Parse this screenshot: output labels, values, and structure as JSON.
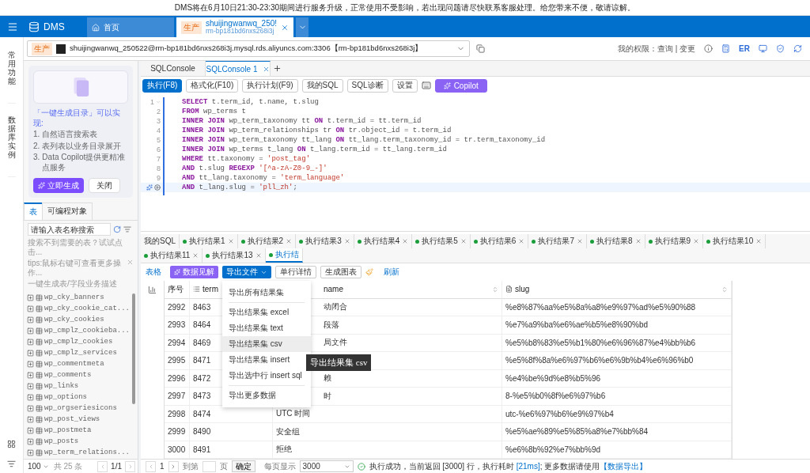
{
  "notice": "DMS将在6月10日21:30-23:30期间进行服务升级，正常使用不受影响，若出现问题请尽快联系客服处理。给您带来不便，敬请谅解。",
  "header": {
    "logo": "DMS",
    "tabs": [
      {
        "kind": "home",
        "title": "首页",
        "selected": false
      },
      {
        "kind": "db",
        "tag": "生产",
        "title": "shuijingwanwq_250!",
        "subtitle": "rm-bp181bd6nxs268i3j",
        "selected": true
      }
    ]
  },
  "rail": {
    "items": [
      "常用功能",
      "数据库实例"
    ]
  },
  "connection": {
    "tag": "生产",
    "text": "shuijingwanwq_250522@rm-bp181bd6nxs268i3j.mysql.rds.aliyuncs.com:3306【rm-bp181bd6nxs268i3j】",
    "permission_label": "我的权限：",
    "permission_query": "查询",
    "permission_sep": "|",
    "permission_change": "变更",
    "er": "ER"
  },
  "copilot_card": {
    "title": "「一键生成目录」可以实现:",
    "points": [
      {
        "no": "1.",
        "text": "自然语言搜索表"
      },
      {
        "no": "2.",
        "text": "表列表以业务目录展开"
      },
      {
        "no": "3.",
        "text": "Data Copilot提供更精准点服务"
      }
    ],
    "primary": "立即生成",
    "secondary": "关闭"
  },
  "object_tabs": [
    {
      "label": "表",
      "selected": true
    },
    {
      "label": "可编程对象",
      "selected": false
    }
  ],
  "table_search": {
    "placeholder": "请输入表名称搜索"
  },
  "hints": [
    {
      "text": "搜索不到需要的表？试试点击...",
      "closable": false
    },
    {
      "text": "tips:鼠标右键可查看更多操作...",
      "closable": true
    },
    {
      "text": "一键生成表/字段业务描述",
      "closable": false
    }
  ],
  "tables": [
    "wp_cky_banners",
    "wp_cky_cookie_cat...",
    "wp_cky_cookies",
    "wp_cmplz_cookieba...",
    "wp_cmplz_cookies",
    "wp_cmplz_services",
    "wp_commentmeta",
    "wp_comments",
    "wp_links",
    "wp_options",
    "wp_orgseriesicons",
    "wp_post_views",
    "wp_postmeta",
    "wp_posts",
    "wp_term_relations..."
  ],
  "tables_footer": {
    "page_size": "100",
    "total": "共 25 条",
    "page": "1/1"
  },
  "console_tabs": [
    {
      "label": "SQLConsole",
      "selected": false,
      "closable": false
    },
    {
      "label": "SQLConsole 1",
      "selected": true,
      "closable": true
    }
  ],
  "toolbar": [
    {
      "label": "执行(F8)",
      "kind": "primary"
    },
    {
      "label": "格式化(F10)",
      "kind": "default"
    },
    {
      "label": "执行计划(F9)",
      "kind": "default"
    },
    {
      "label": "我的SQL",
      "kind": "default"
    },
    {
      "label": "SQL诊断",
      "kind": "default"
    },
    {
      "label": "设置",
      "kind": "default"
    },
    {
      "kind": "keyboard"
    },
    {
      "label": "Copilot",
      "kind": "copilot"
    }
  ],
  "code": [
    {
      "no": "1",
      "current": false,
      "segments": [
        {
          "kind": "keyword",
          "text": "SELECT"
        },
        {
          "kind": "plain",
          "text": " t.term_id, t.name, t.slug"
        }
      ]
    },
    {
      "no": "2",
      "current": false,
      "segments": [
        {
          "kind": "keyword",
          "text": "FROM"
        },
        {
          "kind": "plain",
          "text": " wp_terms t"
        }
      ]
    },
    {
      "no": "3",
      "current": false,
      "segments": [
        {
          "kind": "keyword",
          "text": "INNER JOIN"
        },
        {
          "kind": "plain",
          "text": " wp_term_taxonomy tt "
        },
        {
          "kind": "keyword",
          "text": "ON"
        },
        {
          "kind": "plain",
          "text": " t.term_id = tt.term_id"
        }
      ]
    },
    {
      "no": "4",
      "current": false,
      "segments": [
        {
          "kind": "keyword",
          "text": "INNER JOIN"
        },
        {
          "kind": "plain",
          "text": " wp_term_relationships tr "
        },
        {
          "kind": "keyword",
          "text": "ON"
        },
        {
          "kind": "plain",
          "text": " tr.object_id = t.term_id"
        }
      ]
    },
    {
      "no": "5",
      "current": false,
      "segments": [
        {
          "kind": "keyword",
          "text": "INNER JOIN"
        },
        {
          "kind": "plain",
          "text": " wp_term_taxonomy tt_lang "
        },
        {
          "kind": "keyword",
          "text": "ON"
        },
        {
          "kind": "plain",
          "text": " tt_lang.term_taxonomy_id = tr.term_taxonomy_id"
        }
      ]
    },
    {
      "no": "6",
      "current": false,
      "segments": [
        {
          "kind": "keyword",
          "text": "INNER JOIN"
        },
        {
          "kind": "plain",
          "text": " wp_terms t_lang "
        },
        {
          "kind": "keyword",
          "text": "ON"
        },
        {
          "kind": "plain",
          "text": " t_lang.term_id = tt_lang.term_id"
        }
      ]
    },
    {
      "no": "7",
      "current": false,
      "segments": [
        {
          "kind": "keyword",
          "text": "WHERE"
        },
        {
          "kind": "plain",
          "text": " tt.taxonomy = "
        },
        {
          "kind": "string",
          "text": "'post_tag'"
        }
      ]
    },
    {
      "no": "8",
      "current": false,
      "segments": [
        {
          "kind": "keyword",
          "text": "AND"
        },
        {
          "kind": "plain",
          "text": " t.slug "
        },
        {
          "kind": "keyword",
          "text": "REGEXP"
        },
        {
          "kind": "string",
          "text": " '[^a-zA-Z0-9_-]'"
        }
      ]
    },
    {
      "no": "9",
      "current": false,
      "segments": [
        {
          "kind": "keyword",
          "text": "AND"
        },
        {
          "kind": "plain",
          "text": " tt_lang.taxonomy = "
        },
        {
          "kind": "string",
          "text": "'term_language'"
        }
      ]
    },
    {
      "current": true,
      "segments": [
        {
          "kind": "keyword",
          "text": "AND"
        },
        {
          "kind": "plain",
          "text": " t_lang.slug = "
        },
        {
          "kind": "string",
          "text": "'pll_zh'"
        },
        {
          "kind": "plain",
          "text": ";"
        }
      ]
    }
  ],
  "result_tabs": [
    {
      "kind": "sql",
      "label": "我的SQL",
      "selected": false
    },
    {
      "kind": "result",
      "label": "执行结果1",
      "selected": false
    },
    {
      "kind": "result",
      "label": "执行结果2",
      "selected": false
    },
    {
      "kind": "result",
      "label": "执行结果3",
      "selected": false
    },
    {
      "kind": "result",
      "label": "执行结果4",
      "selected": false
    },
    {
      "kind": "result",
      "label": "执行结果5",
      "selected": false
    },
    {
      "kind": "result",
      "label": "执行结果6",
      "selected": false
    },
    {
      "kind": "result",
      "label": "执行结果7",
      "selected": false
    },
    {
      "kind": "result",
      "label": "执行结果8",
      "selected": false
    },
    {
      "kind": "result",
      "label": "执行结果9",
      "selected": false
    },
    {
      "kind": "result",
      "label": "执行结果10",
      "selected": false
    },
    {
      "kind": "result",
      "label": "执行结果11",
      "selected": false
    },
    {
      "kind": "result",
      "label": "执行结果13",
      "selected": false
    },
    {
      "kind": "partial",
      "label": "执行结",
      "selected": true
    }
  ],
  "result_toolbar": {
    "view": "表格",
    "insight": "数据见解",
    "export": "导出文件",
    "detail": "单行详情",
    "chart": "生成图表",
    "refresh": "刷新"
  },
  "export_menu": {
    "groups": [
      [
        {
          "label": "导出所有结果集",
          "selected": false
        }
      ],
      [
        {
          "label": "导出结果集 excel",
          "selected": false
        },
        {
          "label": "导出结果集 text",
          "selected": false
        },
        {
          "label": "导出结果集 csv",
          "selected": true
        },
        {
          "label": "导出结果集 insert",
          "selected": false
        },
        {
          "label": "导出选中行 insert sql",
          "selected": false
        }
      ],
      [
        {
          "label": "导出更多数据",
          "selected": false
        }
      ]
    ],
    "tooltip": "导出结果集 csv"
  },
  "columns": [
    "序号",
    "term",
    "name",
    "slug"
  ],
  "rows": [
    {
      "no": "2992",
      "term_id": "8463",
      "name": "动闭合",
      "slug": "%e8%87%aa%e5%8a%a8%e9%97%ad%e5%90%88"
    },
    {
      "no": "2993",
      "term_id": "8464",
      "name": "段落",
      "slug": "%e7%a9%ba%e6%ae%b5%e8%90%bd"
    },
    {
      "no": "2994",
      "term_id": "8469",
      "name": "局文件",
      "slug": "%e5%b8%83%e5%b1%80%e6%96%87%e4%bb%b6"
    },
    {
      "no": "2995",
      "term_id": "8471",
      "slug": "%e5%8f%8a%e6%97%b6%e6%9b%b4%e6%96%b0"
    },
    {
      "no": "2996",
      "term_id": "8472",
      "name": "赖",
      "slug": "%e4%be%9d%e8%b5%96"
    },
    {
      "no": "2997",
      "term_id": "8473",
      "name": "时",
      "slug": "8-%e5%b0%8f%e6%97%b6"
    },
    {
      "no": "2998",
      "term_id": "8474",
      "name": "UTC 时间",
      "slug": "utc-%e6%97%b6%e9%97%b4"
    },
    {
      "no": "2999",
      "term_id": "8490",
      "name": "安全组",
      "slug": "%e5%ae%89%e5%85%a8%e7%bb%84"
    },
    {
      "no": "3000",
      "term_id": "8491",
      "name": "拒绝",
      "slug": "%e6%8b%92%e7%bb%9d"
    }
  ],
  "pager": {
    "page": "1",
    "goto_label": "到第",
    "goto_unit": "页",
    "confirm": "确定",
    "size_label": "每页显示",
    "size": "3000"
  },
  "status": {
    "prefix": "执行成功，当前返回 [3000] 行，执行耗时 ",
    "duration": "[21ms]",
    "middle": "; 更多数据请使用",
    "link": "【数据导出】"
  }
}
